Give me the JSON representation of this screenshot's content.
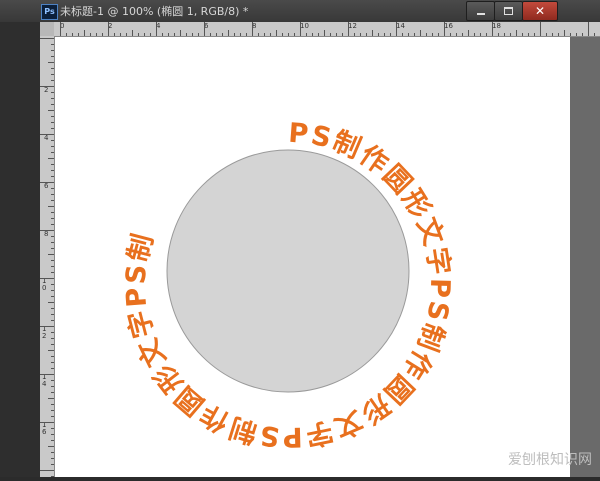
{
  "window": {
    "app_icon": "Ps",
    "title": "未标题-1 @ 100% (椭圆 1, RGB/8) *",
    "close_glyph": "✕"
  },
  "rulers": {
    "top_labels": [
      "0",
      "2",
      "4",
      "6",
      "8",
      "10",
      "12",
      "14",
      "16",
      "18"
    ],
    "left_labels": [
      "2",
      "4",
      "6",
      "8",
      "10",
      "12",
      "14",
      "16"
    ]
  },
  "canvas": {
    "circle_fill": "#d4d4d4",
    "text_color": "#e8701e",
    "ring_text": "PS制作圆形文字PS制作圆形文字PS制作圆形文字PS制"
  },
  "watermark": "爱刨根知识网"
}
